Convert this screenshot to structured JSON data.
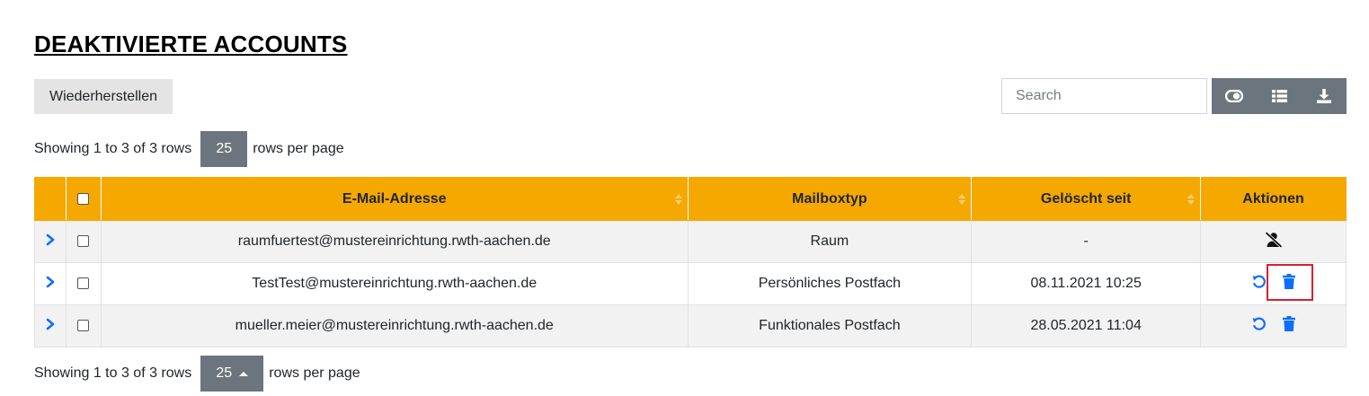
{
  "page": {
    "title": "DEAKTIVIERTE ACCOUNTS"
  },
  "toolbar": {
    "restore_label": "Wiederherstellen",
    "search_placeholder": "Search",
    "icons": [
      "toggle-icon",
      "columns-list-icon",
      "download-icon"
    ]
  },
  "pagination": {
    "showing_text": "Showing 1 to 3 of 3 rows",
    "page_size": "25",
    "rows_per_page_text": "rows per page"
  },
  "table": {
    "columns": [
      "E-Mail-Adresse",
      "Mailboxtyp",
      "Gelöscht seit",
      "Aktionen"
    ],
    "rows": [
      {
        "email": "raumfuertest@mustereinrichtung.rwth-aachen.de",
        "type": "Raum",
        "deleted_since": "-",
        "actions": [
          "user-slash-icon"
        ]
      },
      {
        "email": "TestTest@mustereinrichtung.rwth-aachen.de",
        "type": "Persönliches Postfach",
        "deleted_since": "08.11.2021 10:25",
        "actions": [
          "undo-icon",
          "trash-icon"
        ]
      },
      {
        "email": "mueller.meier@mustereinrichtung.rwth-aachen.de",
        "type": "Funktionales Postfach",
        "deleted_since": "28.05.2021 11:04",
        "actions": [
          "undo-icon",
          "trash-icon"
        ]
      }
    ]
  },
  "colors": {
    "header_bg": "#f5a800",
    "button_gray": "#6c757d",
    "accent_blue": "#0d6efd",
    "highlight_red": "#d9202a"
  }
}
